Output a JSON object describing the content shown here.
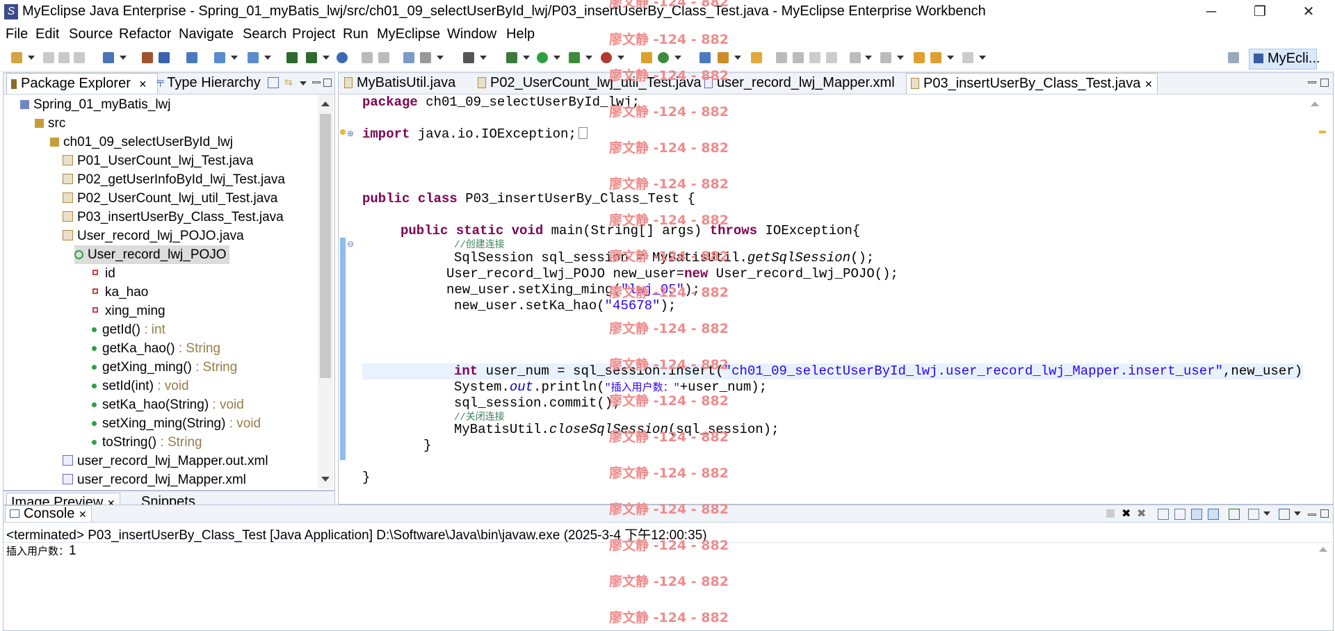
{
  "window": {
    "title": "MyEclipse Java Enterprise - Spring_01_myBatis_lwj/src/ch01_09_selectUserById_lwj/P03_insertUserBy_Class_Test.java - MyEclipse Enterprise Workbench",
    "minimize": "─",
    "restore": "❐",
    "close": "✕"
  },
  "menu": [
    "File",
    "Edit",
    "Source",
    "Refactor",
    "Navigate",
    "Search",
    "Project",
    "Run",
    "MyEclipse",
    "Window",
    "Help"
  ],
  "perspective": {
    "label": "MyEcli..."
  },
  "explorer": {
    "tabs": {
      "package_explorer": "Package Explorer",
      "type_hierarchy": "Type Hierarchy"
    },
    "tree": {
      "project": "Spring_01_myBatis_lwj",
      "src": "src",
      "package": "ch01_09_selectUserById_lwj",
      "files": [
        "P01_UserCount_lwj_Test.java",
        "P02_getUserInfoById_lwj_Test.java",
        "P02_UserCount_lwj_util_Test.java",
        "P03_insertUserBy_Class_Test.java",
        "User_record_lwj_POJO.java"
      ],
      "class": "User_record_lwj_POJO",
      "fields": [
        "id",
        "ka_hao",
        "xing_ming"
      ],
      "methods": [
        {
          "name": "getId()",
          "type": " : int"
        },
        {
          "name": "getKa_hao()",
          "type": " : String"
        },
        {
          "name": "getXing_ming()",
          "type": " : String"
        },
        {
          "name": "setId(int)",
          "type": " : void"
        },
        {
          "name": "setKa_hao(String)",
          "type": " : void"
        },
        {
          "name": "setXing_ming(String)",
          "type": " : void"
        },
        {
          "name": "toString()",
          "type": " : String"
        }
      ],
      "xml_files": [
        "user_record_lwj_Mapper.out.xml",
        "user_record_lwj_Mapper.xml"
      ]
    }
  },
  "bottom_left": {
    "tabs": [
      "Image Preview",
      "Snippets"
    ]
  },
  "editor": {
    "tabs": [
      "MyBatisUtil.java",
      "P02_UserCount_lwj_util_Test.java",
      "user_record_lwj_Mapper.xml",
      "P03_insertUserBy_Class_Test.java"
    ],
    "code": {
      "l1_kw": "package",
      "l1_rest": " ch01_09_selectUserById_lwj;",
      "l2_kw": "import",
      "l2_rest": " java.io.IOException;",
      "l3_kw1": "public",
      "l3_kw2": "class",
      "l3_rest": " P03_insertUserBy_Class_Test {",
      "l4_kw": "public static void",
      "l4_rest": " main(String[] args) ",
      "l4_kw2": "throws",
      "l4_rest2": " IOException{",
      "c1": "//创建连接",
      "l5a": "SqlSession sql_session = MyBatisUtil.",
      "l5b": "getSqlSession",
      "l5c": "();",
      "l6a": "User_record_lwj_POJO new_user=",
      "l6b": "new",
      "l6c": " User_record_lwj_POJO();",
      "l7a": "new_user.setXing_ming(",
      "l7b": "\"lwj_05\"",
      "l7c": ");",
      "l8a": "new_user.setKa_hao(",
      "l8b": "\"45678\"",
      "l8c": ");",
      "l9_kw": "int",
      "l9a": " user_num = sql_session.insert(",
      "l9b": "\"ch01_09_selectUserById_lwj.user_record_lwj_Mapper.insert_user\"",
      "l9c": ",new_user);",
      "l10a": "System.",
      "l10b": "out",
      "l10c": ".println(",
      "l10d": "\"插入用户数：\"",
      "l10e": "+user_num);",
      "l11": "sql_session.commit();",
      "c2": "//关闭连接",
      "l12a": "MyBatisUtil.",
      "l12b": "closeSqlSession",
      "l12c": "(sql_session);",
      "l13": "}",
      "l14": "}"
    }
  },
  "console": {
    "tab": "Console",
    "status": "<terminated> P03_insertUserBy_Class_Test [Java Application] D:\\Software\\Java\\bin\\javaw.exe (2025-3-4 下午12:00:35)",
    "output_label": "插入用户数：",
    "output_value": "1"
  },
  "watermark": "廖文静 -124 - 882",
  "colors": {
    "keyword": "#7f0055",
    "string": "#2a00ff",
    "comment": "#3f7f5f",
    "type": "#957d47",
    "watermark": "#f08b8b"
  }
}
